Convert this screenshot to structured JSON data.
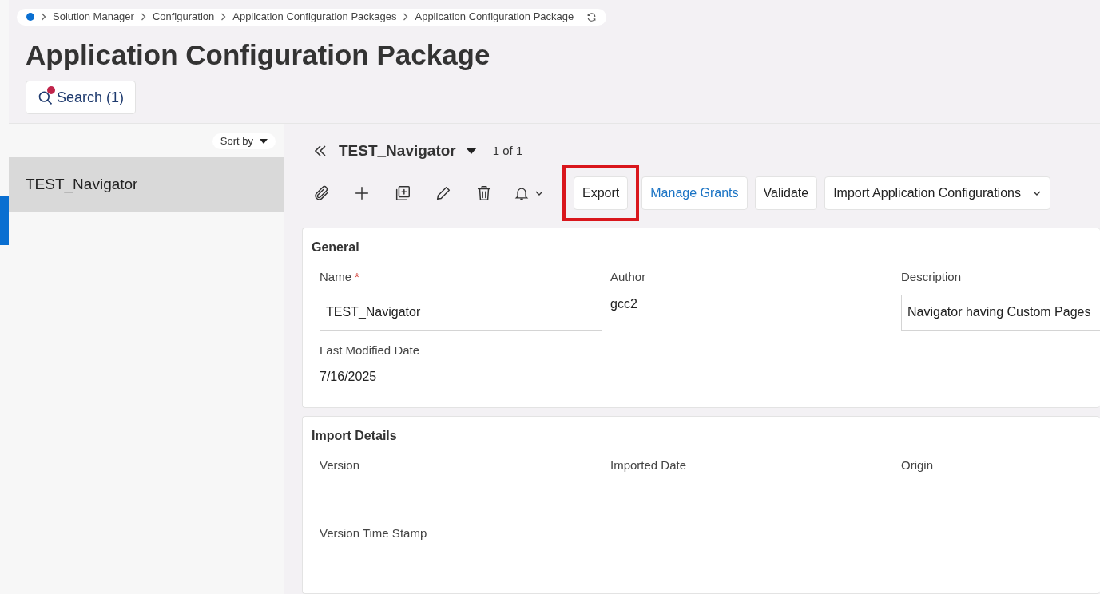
{
  "breadcrumb": [
    "Solution Manager",
    "Configuration",
    "Application Configuration Packages",
    "Application Configuration Package"
  ],
  "page_title": "Application Configuration Package",
  "search_button": {
    "label": "Search (1)",
    "has_filter": true
  },
  "list": {
    "sort_label": "Sort by",
    "items": [
      {
        "label": "TEST_Navigator",
        "selected": true
      }
    ]
  },
  "record": {
    "title": "TEST_Navigator",
    "counter": "1 of 1"
  },
  "actions": [
    {
      "label": "Export",
      "kind": "plain",
      "highlighted": true
    },
    {
      "label": "Manage Grants",
      "kind": "link",
      "highlighted": false
    },
    {
      "label": "Validate",
      "kind": "plain",
      "highlighted": false
    },
    {
      "label": "Import Application Configurations",
      "kind": "menu",
      "highlighted": false
    }
  ],
  "sections": [
    {
      "title": "General",
      "fields": [
        {
          "label": "Name",
          "required_mark": "*",
          "kind": "input",
          "value": "TEST_Navigator"
        },
        {
          "label": "Author",
          "kind": "text",
          "value": "gcc2"
        },
        {
          "label": "Description",
          "kind": "input",
          "value": "Navigator having Custom Pages"
        },
        {
          "label": "Last Modified Date",
          "kind": "text",
          "value": "7/16/2025"
        }
      ]
    },
    {
      "title": "Import Details",
      "fields": [
        {
          "label": "Version"
        },
        {
          "label": "Imported Date"
        },
        {
          "label": "Origin"
        },
        {
          "label": "Version Time Stamp"
        }
      ]
    }
  ]
}
